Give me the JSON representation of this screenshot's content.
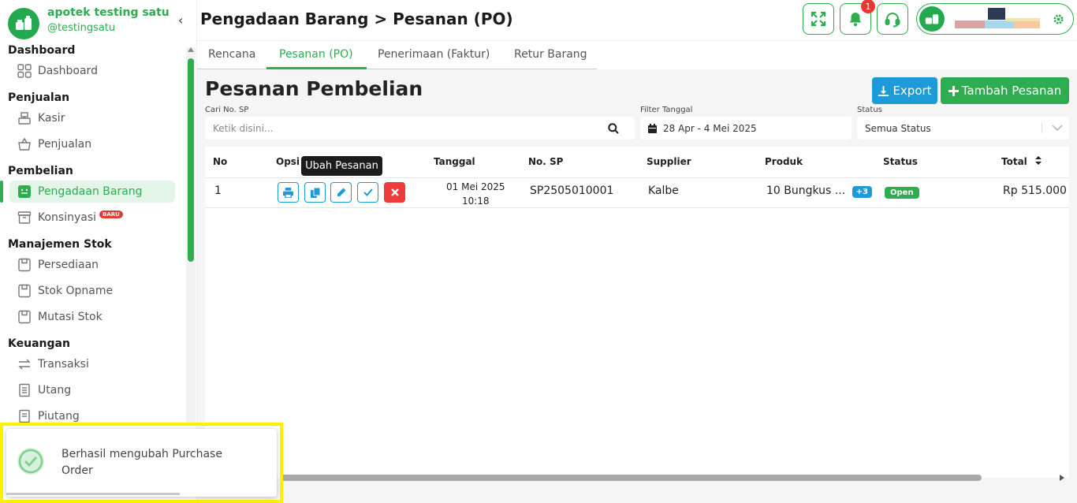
{
  "brand": {
    "name": "apotek testing satu",
    "username": "@testingsatu"
  },
  "sidebar": {
    "sections": [
      {
        "title": "Dashboard",
        "items": [
          {
            "label": "Dashboard",
            "icon": "grid-icon"
          }
        ]
      },
      {
        "title": "Penjualan",
        "items": [
          {
            "label": "Kasir",
            "icon": "cash-register-icon"
          },
          {
            "label": "Penjualan",
            "icon": "basket-icon"
          }
        ]
      },
      {
        "title": "Pembelian",
        "items": [
          {
            "label": "Pengadaan Barang",
            "icon": "procurement-icon",
            "active": true
          },
          {
            "label": "Konsinyasi",
            "icon": "archive-box-icon",
            "badge": "BARU"
          }
        ]
      },
      {
        "title": "Manajemen Stok",
        "items": [
          {
            "label": "Persediaan",
            "icon": "inventory-icon"
          },
          {
            "label": "Stok Opname",
            "icon": "stock-opname-icon"
          },
          {
            "label": "Mutasi Stok",
            "icon": "stock-transfer-icon"
          }
        ]
      },
      {
        "title": "Keuangan",
        "items": [
          {
            "label": "Transaksi",
            "icon": "transaction-icon"
          },
          {
            "label": "Utang",
            "icon": "receipt-icon"
          },
          {
            "label": "Piutang",
            "icon": "receipt-icon"
          }
        ]
      }
    ]
  },
  "header": {
    "title": "Pengadaan Barang > Pesanan (PO)",
    "notification_count": "1"
  },
  "tabs": [
    {
      "label": "Rencana"
    },
    {
      "label": "Pesanan (PO)",
      "active": true
    },
    {
      "label": "Penerimaan (Faktur)"
    },
    {
      "label": "Retur Barang"
    }
  ],
  "main": {
    "title": "Pesanan Pembelian",
    "export_label": "Export",
    "add_label": "Tambah Pesanan"
  },
  "filters": {
    "search_label": "Cari No. SP",
    "search_placeholder": "Ketik disini...",
    "date_label": "Filter Tanggal",
    "date_value": "28 Apr - 4 Mei 2025",
    "status_label": "Status",
    "status_value": "Semua Status"
  },
  "table": {
    "headers": [
      "No",
      "Opsi",
      "Tanggal",
      "No. SP",
      "Supplier",
      "Produk",
      "Status",
      "Total"
    ],
    "tooltip": "Ubah Pesanan",
    "rows": [
      {
        "no": "1",
        "date": "01 Mei 2025",
        "time": "10:18",
        "sp": "SP2505010001",
        "supplier": "Kalbe",
        "product": "10 Bungkus ...",
        "product_more": "+3",
        "status": "Open",
        "total": "Rp 515.000"
      }
    ]
  },
  "toast": {
    "message": "Berhasil mengubah Purchase Order"
  },
  "colors": {
    "primary": "#2eac4f",
    "info": "#1e9ad6",
    "danger": "#ef3b3b",
    "highlight": "#ffef00"
  }
}
